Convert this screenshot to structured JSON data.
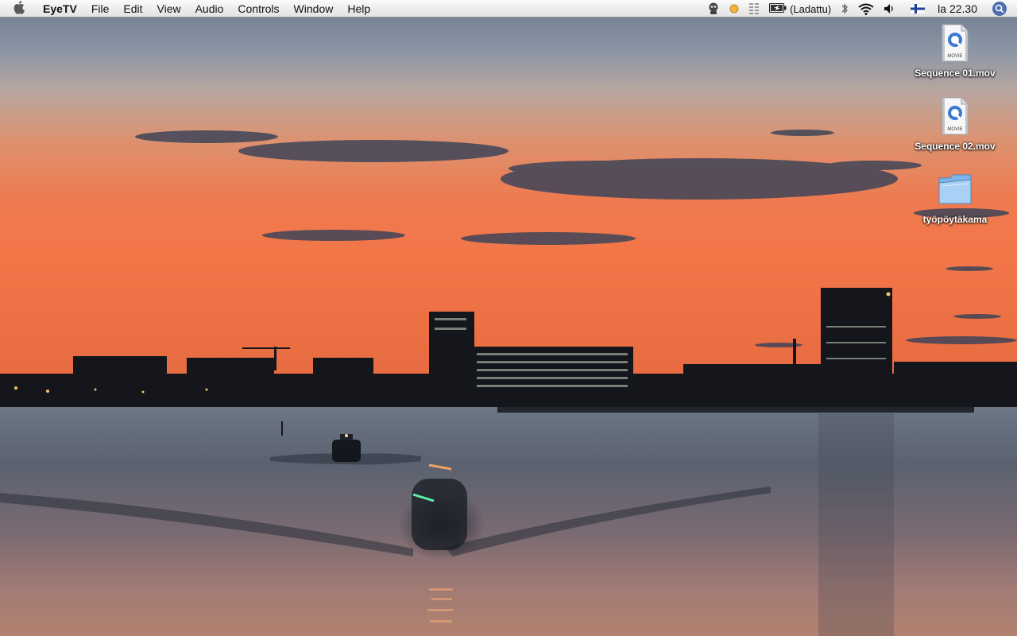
{
  "menubar": {
    "apple_icon": "apple-icon",
    "app_name": "EyeTV",
    "menus": [
      "File",
      "Edit",
      "View",
      "Audio",
      "Controls",
      "Window",
      "Help"
    ],
    "status": {
      "eyetv_icon": "eyetv-robot-icon",
      "record_indicator_icon": "record-indicator-icon",
      "grip_icon": "grip-icon",
      "battery_icon": "battery-icon",
      "battery_text": "(Ladattu)",
      "bluetooth_icon": "bluetooth-icon",
      "wifi_icon": "wifi-icon",
      "volume_icon": "volume-icon",
      "input_menu_icon": "finnish-flag-icon",
      "clock": "la 22.30",
      "spotlight_icon": "spotlight-search-icon"
    }
  },
  "desktop": {
    "icons": [
      {
        "label": "Sequence 01.mov",
        "icon": "quicktime-movie-icon"
      },
      {
        "label": "Sequence 02.mov",
        "icon": "quicktime-movie-icon"
      },
      {
        "label": "työpöytäkama",
        "icon": "folder-icon"
      }
    ]
  },
  "colors": {
    "sky_top": "#7b8798",
    "sky_orange": "#e8744a",
    "water": "#5d6674"
  }
}
